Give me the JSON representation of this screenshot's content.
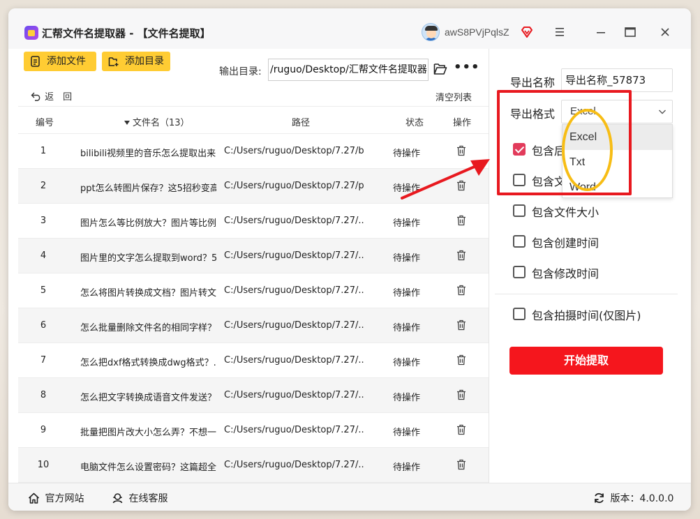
{
  "window": {
    "title": "汇帮文件名提取器 - 【文件名提取】",
    "username": "awS8PVjPqlsZ"
  },
  "toolbar": {
    "add_file": "添加文件",
    "add_dir": "添加目录",
    "output_label": "输出目录:",
    "output_path": "/ruguo/Desktop/汇帮文件名提取器",
    "more": "•••"
  },
  "nav": {
    "back": "返　回",
    "clear": "清空列表"
  },
  "table": {
    "headers": {
      "num": "编号",
      "name": "文件名（13）",
      "path": "路径",
      "status": "状态",
      "op": "操作"
    },
    "rows": [
      {
        "num": "1",
        "name": "bilibili视频里的音乐怎么提取出来...",
        "path": "C:/Users/ruguo/Desktop/7.27/b...",
        "status": "待操作"
      },
      {
        "num": "2",
        "name": "ppt怎么转图片保存？这5招秒变高...",
        "path": "C:/Users/ruguo/Desktop/7.27/p...",
        "status": "待操作"
      },
      {
        "num": "3",
        "name": "图片怎么等比例放大？图片等比例...",
        "path": "C:/Users/ruguo/Desktop/7.27/...",
        "status": "待操作"
      },
      {
        "num": "4",
        "name": "图片里的文字怎么提取到word？5...",
        "path": "C:/Users/ruguo/Desktop/7.27/...",
        "status": "待操作"
      },
      {
        "num": "5",
        "name": "怎么将图片转换成文档？图片转文...",
        "path": "C:/Users/ruguo/Desktop/7.27/...",
        "status": "待操作"
      },
      {
        "num": "6",
        "name": "怎么批量删除文件名的相同字样？...",
        "path": "C:/Users/ruguo/Desktop/7.27/...",
        "status": "待操作"
      },
      {
        "num": "7",
        "name": "怎么把dxf格式转换成dwg格式？...",
        "path": "C:/Users/ruguo/Desktop/7.27/...",
        "status": "待操作"
      },
      {
        "num": "8",
        "name": "怎么把文字转换成语音文件发送？...",
        "path": "C:/Users/ruguo/Desktop/7.27/...",
        "status": "待操作"
      },
      {
        "num": "9",
        "name": "批量把图片改大小怎么弄？不想一...",
        "path": "C:/Users/ruguo/Desktop/7.27/...",
        "status": "待操作"
      },
      {
        "num": "10",
        "name": "电脑文件怎么设置密码？这篇超全...",
        "path": "C:/Users/ruguo/Desktop/7.27/...",
        "status": "待操作"
      }
    ]
  },
  "settings": {
    "name_label": "导出名称",
    "name_value": "导出名称_57873",
    "format_label": "导出格式",
    "format_value": "Excel",
    "format_options": [
      "Excel",
      "Txt",
      "Word"
    ],
    "checkboxes": [
      {
        "label": "包含后",
        "checked": true
      },
      {
        "label": "包含文",
        "checked": false
      },
      {
        "label": "包含文件大小",
        "checked": false
      },
      {
        "label": "包含创建时间",
        "checked": false
      },
      {
        "label": "包含修改时间",
        "checked": false
      },
      {
        "label": "包含拍摄时间(仅图片)",
        "checked": false
      }
    ],
    "start": "开始提取"
  },
  "footer": {
    "site": "官方网站",
    "service": "在线客服",
    "version": "版本：4.0.0.0"
  },
  "colors": {
    "accent_yellow": "#ffcc33",
    "start_red": "#f5161d",
    "checkbox_red": "#e23b5b",
    "annotation_red": "#e8191f",
    "annotation_yellow": "#f7bd15"
  }
}
